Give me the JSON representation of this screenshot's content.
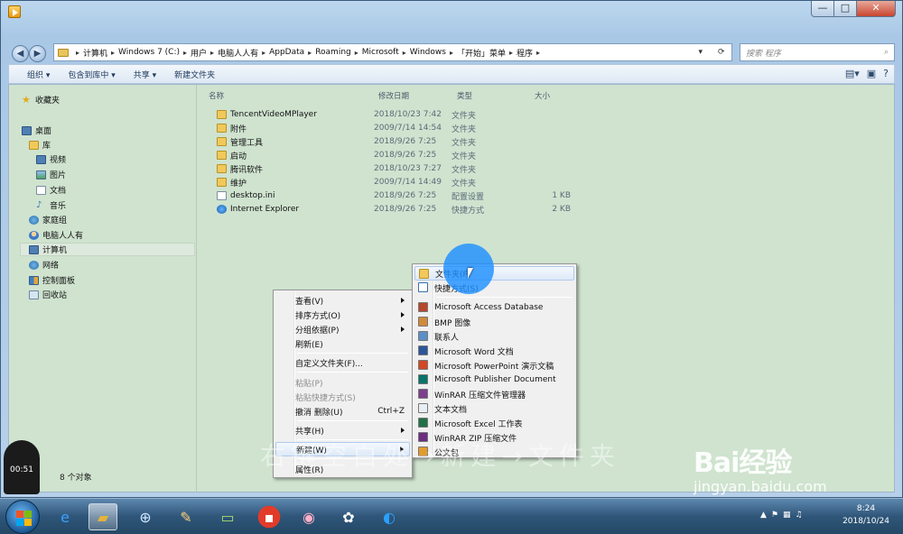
{
  "window": {
    "min_glyph": "—",
    "max_glyph": "□",
    "close_glyph": "✕"
  },
  "address": {
    "crumbs": [
      "计算机",
      "Windows 7 (C:)",
      "用户",
      "电脑人人有",
      "AppData",
      "Roaming",
      "Microsoft",
      "Windows",
      "「开始」菜单",
      "程序"
    ],
    "search_placeholder": "搜索 程序"
  },
  "toolbar": {
    "organize": "组织 ▾",
    "include": "包含到库中 ▾",
    "share": "共享 ▾",
    "new_folder": "新建文件夹"
  },
  "nav": {
    "favorites": "收藏夹",
    "desktop": "桌面",
    "libraries": "库",
    "videos": "视频",
    "pictures": "图片",
    "documents": "文档",
    "music": "音乐",
    "homegroup": "家庭组",
    "user": "电脑人人有",
    "computer": "计算机",
    "network": "网络",
    "control_panel": "控制面板",
    "recycle_bin": "回收站"
  },
  "columns": {
    "name": "名称",
    "date": "修改日期",
    "type": "类型",
    "size": "大小"
  },
  "files": [
    {
      "name": "TencentVideoMPlayer",
      "date": "2018/10/23 7:42",
      "type": "文件夹",
      "size": "",
      "icon": "folder-icon"
    },
    {
      "name": "附件",
      "date": "2009/7/14 14:54",
      "type": "文件夹",
      "size": "",
      "icon": "folder-icon"
    },
    {
      "name": "管理工具",
      "date": "2018/9/26 7:25",
      "type": "文件夹",
      "size": "",
      "icon": "folder-icon"
    },
    {
      "name": "启动",
      "date": "2018/9/26 7:25",
      "type": "文件夹",
      "size": "",
      "icon": "folder-icon"
    },
    {
      "name": "腾讯软件",
      "date": "2018/10/23 7:27",
      "type": "文件夹",
      "size": "",
      "icon": "folder-icon"
    },
    {
      "name": "维护",
      "date": "2009/7/14 14:49",
      "type": "文件夹",
      "size": "",
      "icon": "folder-icon"
    },
    {
      "name": "desktop.ini",
      "date": "2018/9/26 7:25",
      "type": "配置设置",
      "size": "1 KB",
      "icon": "settings-file-icon"
    },
    {
      "name": "Internet Explorer",
      "date": "2018/9/26 7:25",
      "type": "快捷方式",
      "size": "2 KB",
      "icon": "ie-shortcut-icon"
    }
  ],
  "status": {
    "count": "8 个对象"
  },
  "context_menu": {
    "view": "查看(V)",
    "sort": "排序方式(O)",
    "group": "分组依据(P)",
    "refresh": "刷新(E)",
    "customize": "自定义文件夹(F)...",
    "paste": "粘贴(P)",
    "paste_shortcut": "粘贴快捷方式(S)",
    "undo": "撤消 删除(U)",
    "undo_shortcut": "Ctrl+Z",
    "share": "共享(H)",
    "new": "新建(W)",
    "properties": "属性(R)"
  },
  "new_submenu": {
    "folder": "文件夹(F)",
    "shortcut": "快捷方式(S)",
    "items": [
      "Microsoft Access Database",
      "BMP 图像",
      "联系人",
      "Microsoft Word 文档",
      "Microsoft PowerPoint 演示文稿",
      "Microsoft Publisher Document",
      "WinRAR 压缩文件管理器",
      "文本文档",
      "Microsoft Excel 工作表",
      "WinRAR ZIP 压缩文件",
      "公文包"
    ]
  },
  "overlay": {
    "instruction_watermark": "右键空白处→新建→文件夹",
    "baidu_logo_text": "Bai经验",
    "baidu_url": "jingyan.baidu.com",
    "timer": "00:51"
  },
  "taskbar": {
    "time": "8:24",
    "date": "2018/10/24"
  },
  "colors": {
    "content_bg": "#cfe3cf",
    "highlight": "#1e90ff",
    "taskbar": "#2f5679"
  }
}
